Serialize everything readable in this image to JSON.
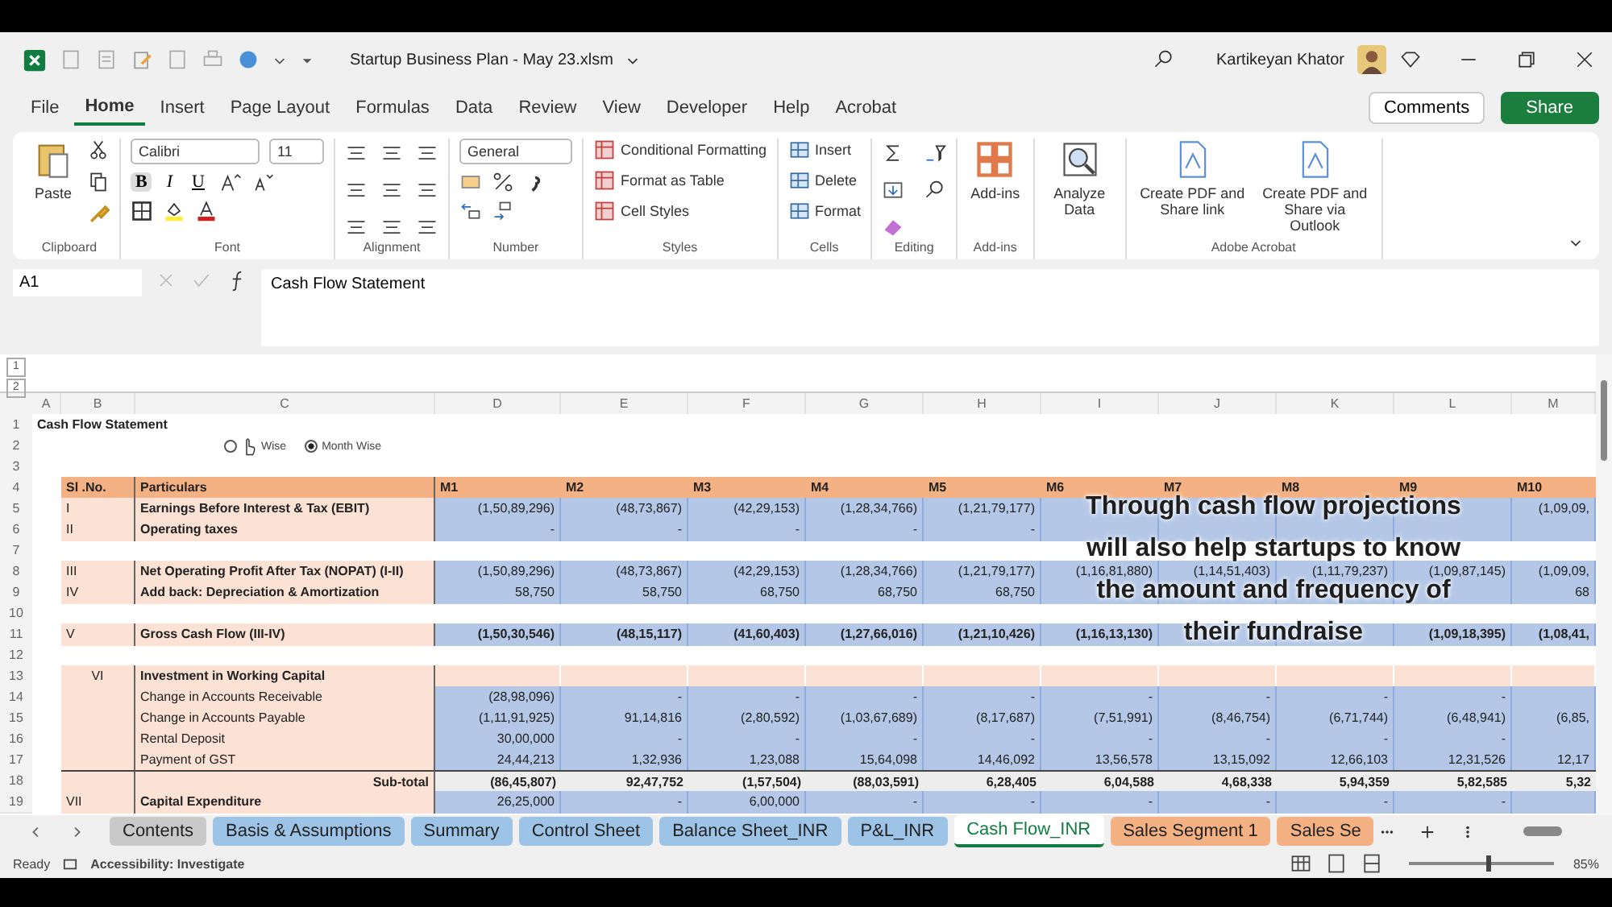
{
  "window": {
    "title": "Startup Business Plan - May 23.xlsm",
    "user": "Kartikeyan Khator"
  },
  "menu_tabs": [
    {
      "label": "File",
      "selected": false
    },
    {
      "label": "Home",
      "selected": true
    },
    {
      "label": "Insert",
      "selected": false
    },
    {
      "label": "Page Layout",
      "selected": false
    },
    {
      "label": "Formulas",
      "selected": false
    },
    {
      "label": "Data",
      "selected": false
    },
    {
      "label": "Review",
      "selected": false
    },
    {
      "label": "View",
      "selected": false
    },
    {
      "label": "Developer",
      "selected": false
    },
    {
      "label": "Help",
      "selected": false
    },
    {
      "label": "Acrobat",
      "selected": false
    }
  ],
  "header_buttons": {
    "comments": "Comments",
    "share": "Share"
  },
  "ribbon": {
    "clipboard": {
      "paste": "Paste",
      "label": "Clipboard"
    },
    "font": {
      "name": "Calibri",
      "size": "11",
      "label": "Font",
      "style_buttons": [
        {
          "label": "B",
          "selected": true
        },
        {
          "label": "I",
          "selected": false
        },
        {
          "label": "U",
          "selected": false
        }
      ]
    },
    "alignment": {
      "label": "Alignment"
    },
    "number": {
      "format": "General",
      "label": "Number"
    },
    "styles": {
      "items": [
        "Conditional Formatting",
        "Format as Table",
        "Cell Styles"
      ],
      "label": "Styles"
    },
    "cells": {
      "items": [
        "Insert",
        "Delete",
        "Format"
      ],
      "label": "Cells"
    },
    "editing": {
      "label": "Editing"
    },
    "addins": {
      "button": "Add-ins",
      "label": "Add-ins"
    },
    "analyze": {
      "button": "Analyze Data"
    },
    "acrobat": {
      "buttons": [
        "Create PDF and Share link",
        "Create PDF and Share via Outlook"
      ],
      "label": "Adobe Acrobat"
    }
  },
  "formula_bar": {
    "name_box": "A1",
    "formula": "Cash Flow Statement"
  },
  "sheet": {
    "outline_levels": [
      "1",
      "2"
    ],
    "column_headers": [
      "A",
      "B",
      "C",
      "D",
      "E",
      "F",
      "G",
      "H",
      "I",
      "J",
      "K",
      "L",
      "M"
    ],
    "rows": [
      {
        "n": "1",
        "kind": "title",
        "title": "Cash Flow Statement"
      },
      {
        "n": "2",
        "kind": "options",
        "options": [
          {
            "label": "Wise",
            "selected": false
          },
          {
            "label": "Month Wise",
            "selected": true
          }
        ]
      },
      {
        "n": "3",
        "kind": "blank"
      },
      {
        "n": "4",
        "kind": "header",
        "b": "Sl .No.",
        "c": "Particulars",
        "values": [
          "M1",
          "M2",
          "M3",
          "M4",
          "M5",
          "M6",
          "M7",
          "M8",
          "M9",
          "M10"
        ]
      },
      {
        "n": "5",
        "kind": "data",
        "b": "I",
        "c": "Earnings Before Interest & Tax (EBIT)",
        "label_bold": true,
        "values_bold": false,
        "cells": [
          {
            "kind": "value",
            "text": "(1,50,89,296)"
          },
          {
            "kind": "value",
            "text": "(48,73,867)"
          },
          {
            "kind": "value",
            "text": "(42,29,153)"
          },
          {
            "kind": "value",
            "text": "(1,28,34,766)"
          },
          {
            "kind": "value",
            "text": "(1,21,79,177)"
          },
          {
            "kind": "empty"
          },
          {
            "kind": "empty"
          },
          {
            "kind": "empty"
          },
          {
            "kind": "empty"
          },
          {
            "kind": "value",
            "text": "(1,09,09,"
          }
        ]
      },
      {
        "n": "6",
        "kind": "data",
        "b": "II",
        "c": "Operating taxes",
        "label_bold": true,
        "values_bold": false,
        "cells": [
          {
            "kind": "value",
            "text": "-"
          },
          {
            "kind": "value",
            "text": "-"
          },
          {
            "kind": "value",
            "text": "-"
          },
          {
            "kind": "value",
            "text": "-"
          },
          {
            "kind": "value",
            "text": "-"
          },
          {
            "kind": "empty"
          },
          {
            "kind": "empty"
          },
          {
            "kind": "empty"
          },
          {
            "kind": "empty"
          },
          {
            "kind": "empty"
          }
        ]
      },
      {
        "n": "7",
        "kind": "blank"
      },
      {
        "n": "8",
        "kind": "data",
        "b": "III",
        "c": "Net Operating Profit After Tax (NOPAT) (I-II)",
        "label_bold": true,
        "values_bold": false,
        "cells": [
          {
            "kind": "value",
            "text": "(1,50,89,296)"
          },
          {
            "kind": "value",
            "text": "(48,73,867)"
          },
          {
            "kind": "value",
            "text": "(42,29,153)"
          },
          {
            "kind": "value",
            "text": "(1,28,34,766)"
          },
          {
            "kind": "value",
            "text": "(1,21,79,177)"
          },
          {
            "kind": "value",
            "text": "(1,16,81,880)"
          },
          {
            "kind": "value",
            "text": "(1,14,51,403)"
          },
          {
            "kind": "value",
            "text": "(1,11,79,237)"
          },
          {
            "kind": "value",
            "text": "(1,09,87,145)"
          },
          {
            "kind": "value",
            "text": "(1,09,09,"
          }
        ]
      },
      {
        "n": "9",
        "kind": "data",
        "b": "IV",
        "c": "Add back: Depreciation & Amortization",
        "label_bold": true,
        "values_bold": false,
        "cells": [
          {
            "kind": "value",
            "text": "58,750"
          },
          {
            "kind": "value",
            "text": "58,750"
          },
          {
            "kind": "value",
            "text": "68,750"
          },
          {
            "kind": "value",
            "text": "68,750"
          },
          {
            "kind": "value",
            "text": "68,750"
          },
          {
            "kind": "empty"
          },
          {
            "kind": "empty"
          },
          {
            "kind": "empty"
          },
          {
            "kind": "empty"
          },
          {
            "kind": "value",
            "text": "68"
          }
        ]
      },
      {
        "n": "10",
        "kind": "blank"
      },
      {
        "n": "11",
        "kind": "data",
        "b": "V",
        "c": "Gross Cash Flow (III-IV)",
        "label_bold": true,
        "values_bold": true,
        "cells": [
          {
            "kind": "value",
            "text": "(1,50,30,546)"
          },
          {
            "kind": "value",
            "text": "(48,15,117)"
          },
          {
            "kind": "value",
            "text": "(41,60,403)"
          },
          {
            "kind": "value",
            "text": "(1,27,66,016)"
          },
          {
            "kind": "value",
            "text": "(1,21,10,426)"
          },
          {
            "kind": "value",
            "text": "(1,16,13,130)"
          },
          {
            "kind": "empty"
          },
          {
            "kind": "empty"
          },
          {
            "kind": "value",
            "text": "(1,09,18,395)"
          },
          {
            "kind": "value",
            "text": "(1,08,41,"
          }
        ]
      },
      {
        "n": "12",
        "kind": "blank"
      },
      {
        "n": "13",
        "kind": "section",
        "b": "VI",
        "c": "Investment in Working Capital"
      },
      {
        "n": "14",
        "kind": "data",
        "c": "Change in Accounts Receivable",
        "label_bold": false,
        "values_bold": false,
        "cells": [
          {
            "kind": "value",
            "text": "(28,98,096)"
          },
          {
            "kind": "value",
            "text": "-"
          },
          {
            "kind": "value",
            "text": "-"
          },
          {
            "kind": "value",
            "text": "-"
          },
          {
            "kind": "value",
            "text": "-"
          },
          {
            "kind": "value",
            "text": "-"
          },
          {
            "kind": "value",
            "text": "-"
          },
          {
            "kind": "value",
            "text": "-"
          },
          {
            "kind": "value",
            "text": "-"
          },
          {
            "kind": "empty"
          }
        ]
      },
      {
        "n": "15",
        "kind": "data",
        "c": "Change in Accounts Payable",
        "label_bold": false,
        "values_bold": false,
        "values": [
          "(1,11,91,925)",
          "91,14,816",
          "(2,80,592)",
          "(1,03,67,689)",
          "(8,17,687)",
          "(7,51,991)",
          "(8,46,754)",
          "(6,71,744)",
          "(6,48,941)",
          "(6,85,"
        ]
      },
      {
        "n": "16",
        "kind": "data",
        "c": "Rental Deposit",
        "label_bold": false,
        "values_bold": false,
        "cells": [
          {
            "kind": "value",
            "text": "30,00,000"
          },
          {
            "kind": "value",
            "text": "-"
          },
          {
            "kind": "value",
            "text": "-"
          },
          {
            "kind": "value",
            "text": "-"
          },
          {
            "kind": "value",
            "text": "-"
          },
          {
            "kind": "value",
            "text": "-"
          },
          {
            "kind": "value",
            "text": "-"
          },
          {
            "kind": "value",
            "text": "-"
          },
          {
            "kind": "value",
            "text": "-"
          },
          {
            "kind": "empty"
          }
        ]
      },
      {
        "n": "17",
        "kind": "data",
        "c": "Payment of GST",
        "label_bold": false,
        "values_bold": false,
        "values": [
          "24,44,213",
          "1,32,936",
          "1,23,088",
          "15,64,098",
          "14,46,092",
          "13,56,578",
          "13,15,092",
          "12,66,103",
          "12,31,526",
          "12,17"
        ]
      },
      {
        "n": "18",
        "kind": "subtotal",
        "c": "Sub-total",
        "values": [
          "(86,45,807)",
          "92,47,752",
          "(1,57,504)",
          "(88,03,591)",
          "6,28,405",
          "6,04,588",
          "4,68,338",
          "5,94,359",
          "5,82,585",
          "5,32"
        ]
      },
      {
        "n": "19",
        "kind": "data",
        "b": "VII",
        "c": "Capital Expenditure",
        "label_bold": true,
        "values_bold": false,
        "cells": [
          {
            "kind": "value",
            "text": "26,25,000"
          },
          {
            "kind": "value",
            "text": "-"
          },
          {
            "kind": "value",
            "text": "6,00,000"
          },
          {
            "kind": "value",
            "text": "-"
          },
          {
            "kind": "value",
            "text": "-"
          },
          {
            "kind": "value",
            "text": "-"
          },
          {
            "kind": "value",
            "text": "-"
          },
          {
            "kind": "value",
            "text": "-"
          },
          {
            "kind": "value",
            "text": "-"
          },
          {
            "kind": "empty"
          }
        ]
      }
    ]
  },
  "caption": [
    "Through cash flow projections",
    "will also help startups to know",
    "the amount and frequency of",
    "their fundraise"
  ],
  "sheet_tabs": [
    {
      "label": "Contents",
      "color": "#c9c9c9",
      "selected": false
    },
    {
      "label": "Basis & Assumptions",
      "color": "#9dc3e6",
      "selected": false
    },
    {
      "label": "Summary",
      "color": "#9dc3e6",
      "selected": false
    },
    {
      "label": "Control Sheet",
      "color": "#9dc3e6",
      "selected": false
    },
    {
      "label": "Balance Sheet_INR",
      "color": "#9dc3e6",
      "selected": false
    },
    {
      "label": "P&L_INR",
      "color": "#9dc3e6",
      "selected": false
    },
    {
      "label": "Cash Flow_INR",
      "selected": true
    },
    {
      "label": "Sales Segment 1",
      "color": "#f4b183",
      "selected": false
    },
    {
      "label": "Sales Se",
      "color": "#f4b183",
      "selected": false
    }
  ],
  "status_bar": {
    "mode": "Ready",
    "accessibility": "Accessibility: Investigate",
    "zoom": {
      "level": 0.55,
      "reading": "85%"
    }
  }
}
